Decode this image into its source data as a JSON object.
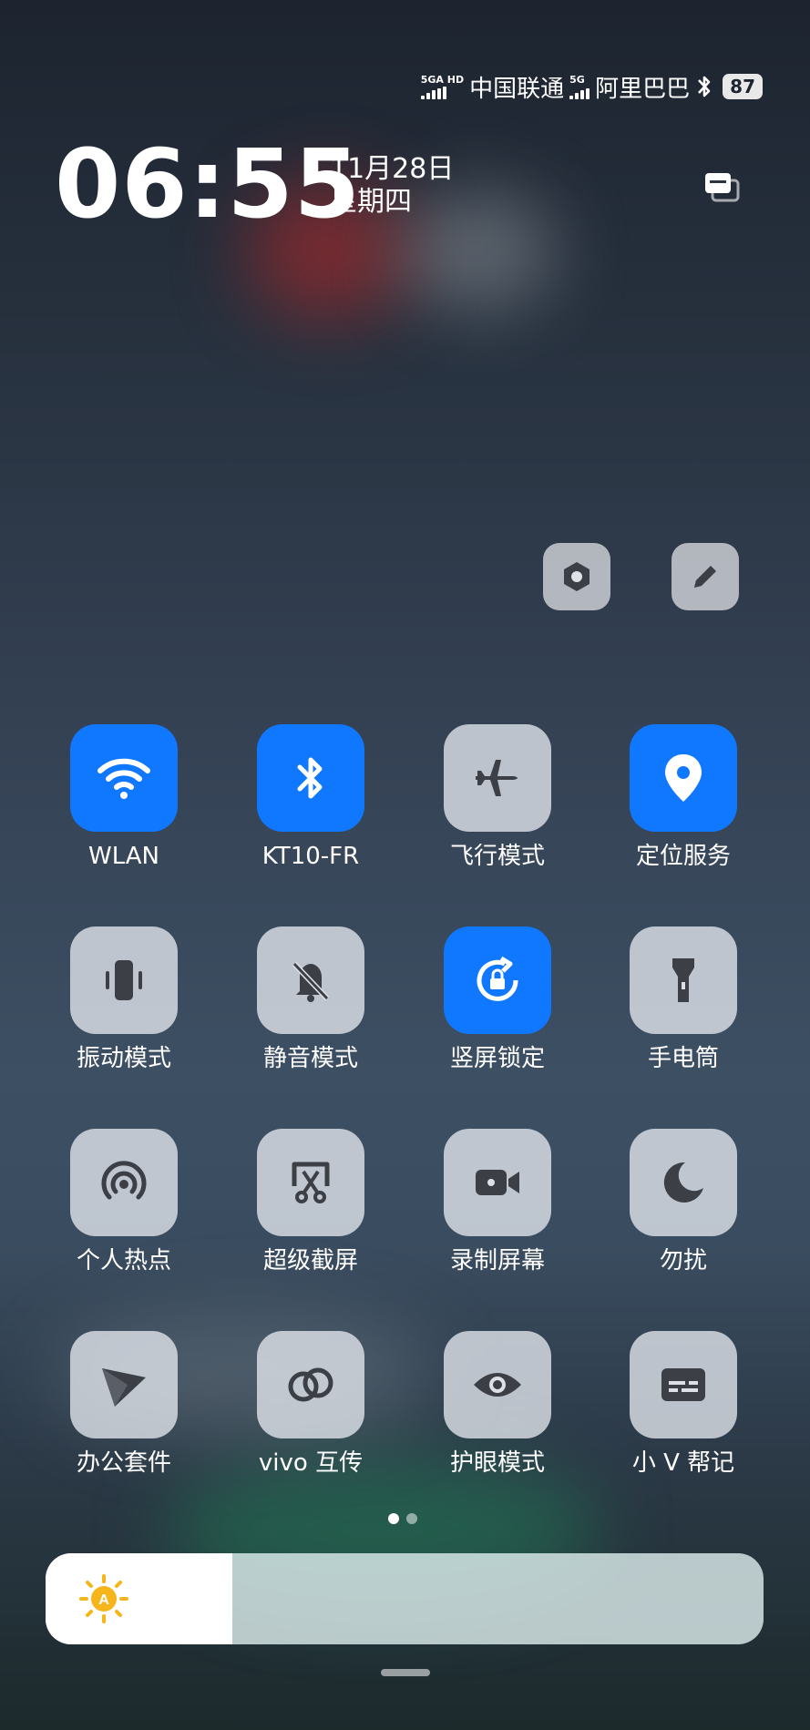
{
  "status_bar": {
    "sim1_tag": "5GA HD",
    "carrier1": "中国联通",
    "sim2_tag": "5G",
    "carrier2": "阿里巴巴",
    "bluetooth_icon": "bluetooth-icon",
    "battery": "87"
  },
  "clock": {
    "time": "06:55",
    "date": "11月28日",
    "weekday": "星期四"
  },
  "top_actions": {
    "settings_icon": "settings-hex-icon",
    "edit_icon": "pencil-icon"
  },
  "tiles": [
    {
      "label": "WLAN",
      "icon": "wifi-icon",
      "active": true
    },
    {
      "label": "KT10-FR",
      "icon": "bluetooth-icon",
      "active": true
    },
    {
      "label": "飞行模式",
      "icon": "airplane-icon",
      "active": false
    },
    {
      "label": "定位服务",
      "icon": "location-pin-icon",
      "active": true
    },
    {
      "label": "振动模式",
      "icon": "vibrate-icon",
      "active": false
    },
    {
      "label": "静音模式",
      "icon": "bell-off-icon",
      "active": false
    },
    {
      "label": "竖屏锁定",
      "icon": "rotation-lock-icon",
      "active": true
    },
    {
      "label": "手电筒",
      "icon": "flashlight-icon",
      "active": false
    },
    {
      "label": "个人热点",
      "icon": "hotspot-icon",
      "active": false
    },
    {
      "label": "超级截屏",
      "icon": "screenshot-icon",
      "active": false
    },
    {
      "label": "录制屏幕",
      "icon": "video-camera-icon",
      "active": false
    },
    {
      "label": "勿扰",
      "icon": "moon-icon",
      "active": false
    },
    {
      "label": "办公套件",
      "icon": "office-arrow-icon",
      "active": false
    },
    {
      "label": "vivo 互传",
      "icon": "link-icon",
      "active": false
    },
    {
      "label": "护眼模式",
      "icon": "eye-icon",
      "active": false
    },
    {
      "label": "小 V 帮记",
      "icon": "note-card-icon",
      "active": false
    }
  ],
  "pager": {
    "pages": 2,
    "current": 1
  },
  "brightness": {
    "icon": "auto-brightness-sun-icon",
    "auto_letter": "A",
    "level": 0.26
  },
  "colors": {
    "accent": "#1078ff",
    "tile_off": "#dde1e7"
  }
}
